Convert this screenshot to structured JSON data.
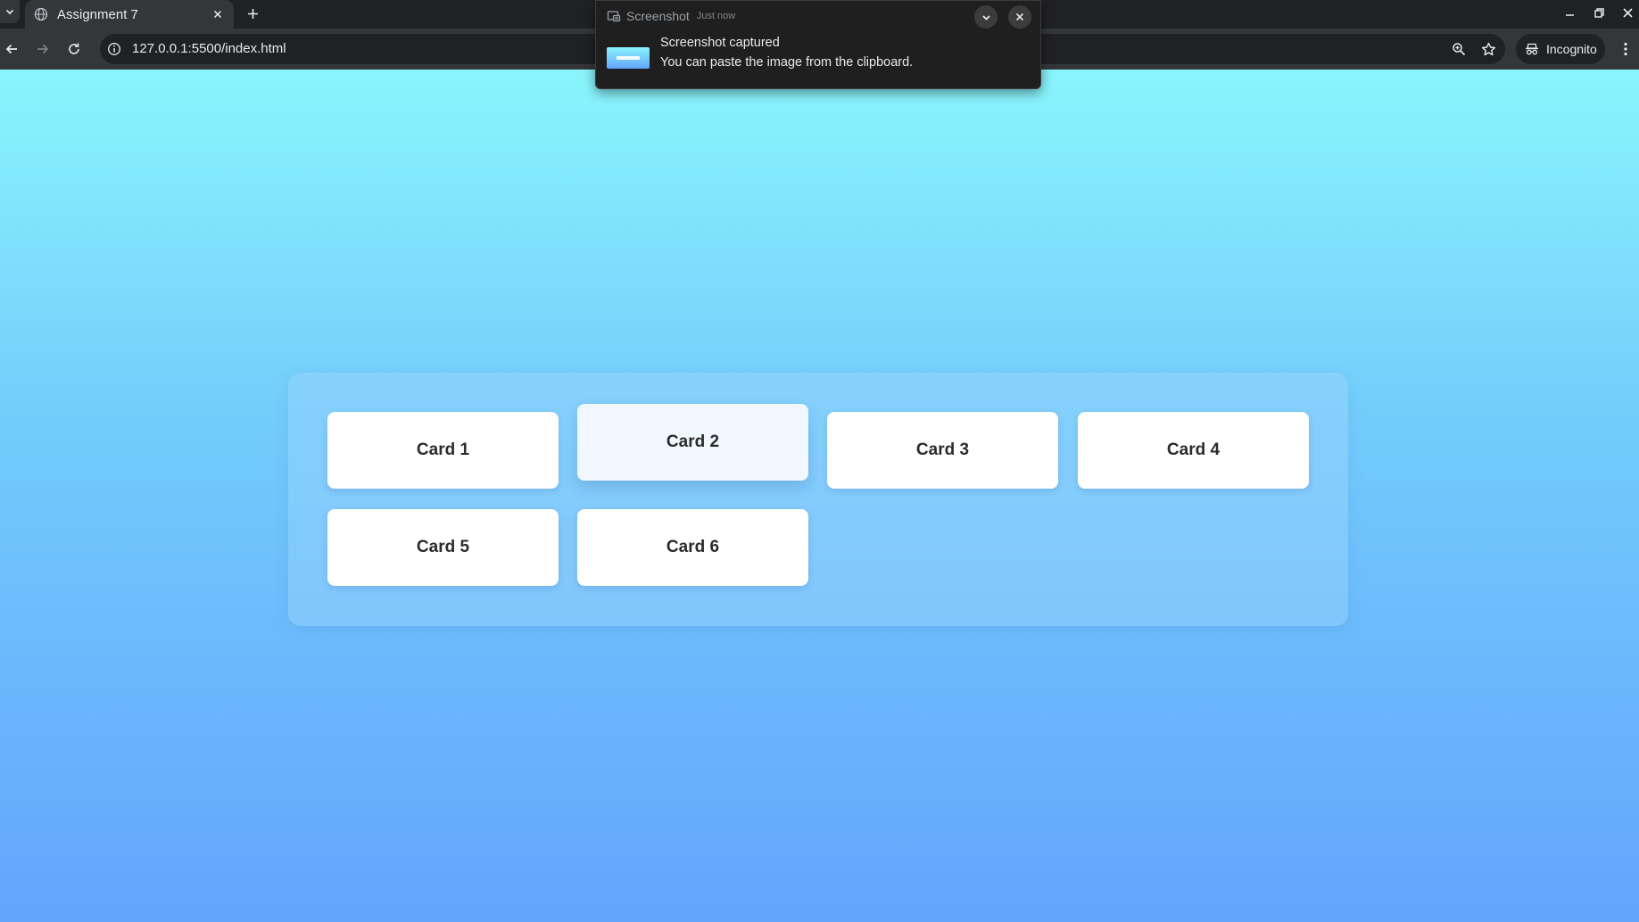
{
  "browser": {
    "tab": {
      "title": "Assignment 7"
    },
    "address_bar": {
      "url": "127.0.0.1:5500/index.html"
    },
    "profile": {
      "label": "Incognito"
    }
  },
  "notification": {
    "app_name": "Screenshot",
    "time": "Just now",
    "title": "Screenshot captured",
    "body": "You can paste the image from the clipboard."
  },
  "page": {
    "cards": [
      {
        "label": "Card 1"
      },
      {
        "label": "Card 2",
        "hovered": true
      },
      {
        "label": "Card 3"
      },
      {
        "label": "Card 4"
      },
      {
        "label": "Card 5"
      },
      {
        "label": "Card 6"
      }
    ]
  },
  "colors": {
    "page_gradient_top": "#8af5fc",
    "page_gradient_bottom": "#63a4fd",
    "card_background": "#ffffff",
    "card_hover_background": "#f0f7fe",
    "card_text": "#2b2b2b"
  }
}
